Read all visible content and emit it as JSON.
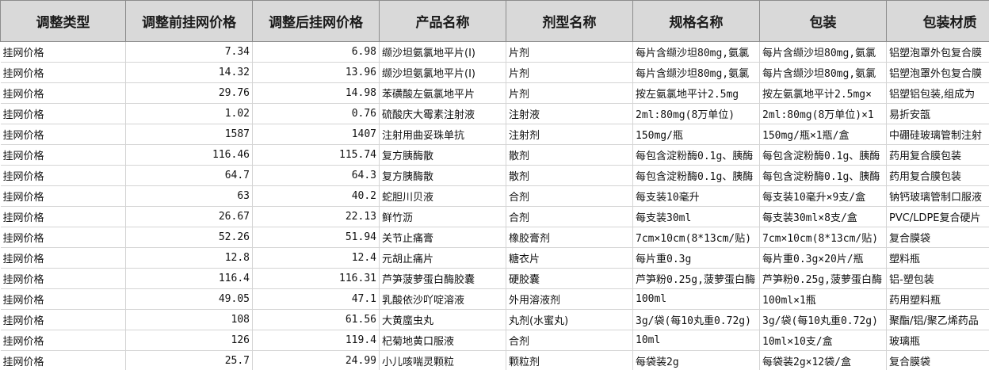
{
  "headers": [
    "调整类型",
    "调整前挂网价格",
    "调整后挂网价格",
    "产品名称",
    "剂型名称",
    "规格名称",
    "包装",
    "包装材质"
  ],
  "rows": [
    [
      "挂网价格",
      "7.34",
      "6.98",
      "缬沙坦氨氯地平片(I)",
      "片剂",
      "每片含缬沙坦80mg,氨氯",
      "每片含缬沙坦80mg,氨氯",
      "铝塑泡罩外包复合膜"
    ],
    [
      "挂网价格",
      "14.32",
      "13.96",
      "缬沙坦氨氯地平片(I)",
      "片剂",
      "每片含缬沙坦80mg,氨氯",
      "每片含缬沙坦80mg,氨氯",
      "铝塑泡罩外包复合膜"
    ],
    [
      "挂网价格",
      "29.76",
      "14.98",
      "苯磺酸左氨氯地平片",
      "片剂",
      "按左氨氯地平计2.5mg",
      "按左氨氯地平计2.5mg×",
      "铝塑铝包装,组成为"
    ],
    [
      "挂网价格",
      "1.02",
      "0.76",
      "硫酸庆大霉素注射液",
      "注射液",
      "2ml:80mg(8万单位)",
      "2ml:80mg(8万单位)×1",
      "易折安瓿"
    ],
    [
      "挂网价格",
      "1587",
      "1407",
      "注射用曲妥珠单抗",
      "注射剂",
      "150mg/瓶",
      "150mg/瓶×1瓶/盒",
      "中硼硅玻璃管制注射"
    ],
    [
      "挂网价格",
      "116.46",
      "115.74",
      "复方胰酶散",
      "散剂",
      "每包含淀粉酶0.1g、胰酶",
      "每包含淀粉酶0.1g、胰酶",
      "药用复合膜包装"
    ],
    [
      "挂网价格",
      "64.7",
      "64.3",
      "复方胰酶散",
      "散剂",
      "每包含淀粉酶0.1g、胰酶",
      "每包含淀粉酶0.1g、胰酶",
      "药用复合膜包装"
    ],
    [
      "挂网价格",
      "63",
      "40.2",
      "蛇胆川贝液",
      "合剂",
      "每支装10毫升",
      "每支装10毫升×9支/盒",
      "钠钙玻璃管制口服液"
    ],
    [
      "挂网价格",
      "26.67",
      "22.13",
      "鲜竹沥",
      "合剂",
      "每支装30ml",
      "每支装30ml×8支/盒",
      "PVC/LDPE复合硬片"
    ],
    [
      "挂网价格",
      "52.26",
      "51.94",
      "关节止痛膏",
      "橡胶膏剂",
      "7cm×10cm(8*13cm/贴)",
      "7cm×10cm(8*13cm/贴)",
      "复合膜袋"
    ],
    [
      "挂网价格",
      "12.8",
      "12.4",
      "元胡止痛片",
      "糖衣片",
      "每片重0.3g",
      "每片重0.3g×20片/瓶",
      "塑料瓶"
    ],
    [
      "挂网价格",
      "116.4",
      "116.31",
      "芦笋菠萝蛋白酶胶囊",
      "硬胶囊",
      "芦笋粉0.25g,菠萝蛋白酶",
      "芦笋粉0.25g,菠萝蛋白酶",
      "铝-塑包装"
    ],
    [
      "挂网价格",
      "49.05",
      "47.1",
      "乳酸依沙吖啶溶液",
      "外用溶液剂",
      "100ml",
      "100ml×1瓶",
      "药用塑料瓶"
    ],
    [
      "挂网价格",
      "108",
      "61.56",
      "大黄䗪虫丸",
      "丸剂(水蜜丸)",
      "3g/袋(每10丸重0.72g)",
      "3g/袋(每10丸重0.72g)",
      "聚酯/铝/聚乙烯药品"
    ],
    [
      "挂网价格",
      "126",
      "119.4",
      "杞菊地黄口服液",
      "合剂",
      "10ml",
      "10ml×10支/盒",
      "玻璃瓶"
    ],
    [
      "挂网价格",
      "25.7",
      "24.99",
      "小儿咳喘灵颗粒",
      "颗粒剂",
      "每袋装2g",
      "每袋装2g×12袋/盒",
      "复合膜袋"
    ]
  ]
}
